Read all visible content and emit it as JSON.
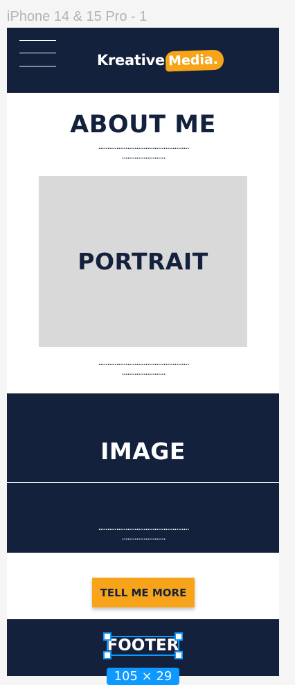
{
  "frame": {
    "label": "iPhone 14 & 15 Pro - 1"
  },
  "nav": {
    "logo_primary": "Kreative",
    "logo_secondary": "Media."
  },
  "about": {
    "title": "ABOUT ME",
    "dots_top_1": "..................................................",
    "dots_top_2": "........................",
    "portrait_label": "PORTRAIT",
    "dots_bottom_1": "..................................................",
    "dots_bottom_2": "........................"
  },
  "image_section": {
    "label": "IMAGE",
    "dots_1": "..................................................",
    "dots_2": "........................"
  },
  "cta": {
    "label": "TELL ME MORE"
  },
  "footer": {
    "label": "FOOTER"
  },
  "selection": {
    "size_badge": "105 × 29"
  },
  "colors": {
    "navy": "#13213c",
    "accent": "#f7a41a",
    "placeholder": "#d9d9d9",
    "selection": "#0d99ff"
  }
}
